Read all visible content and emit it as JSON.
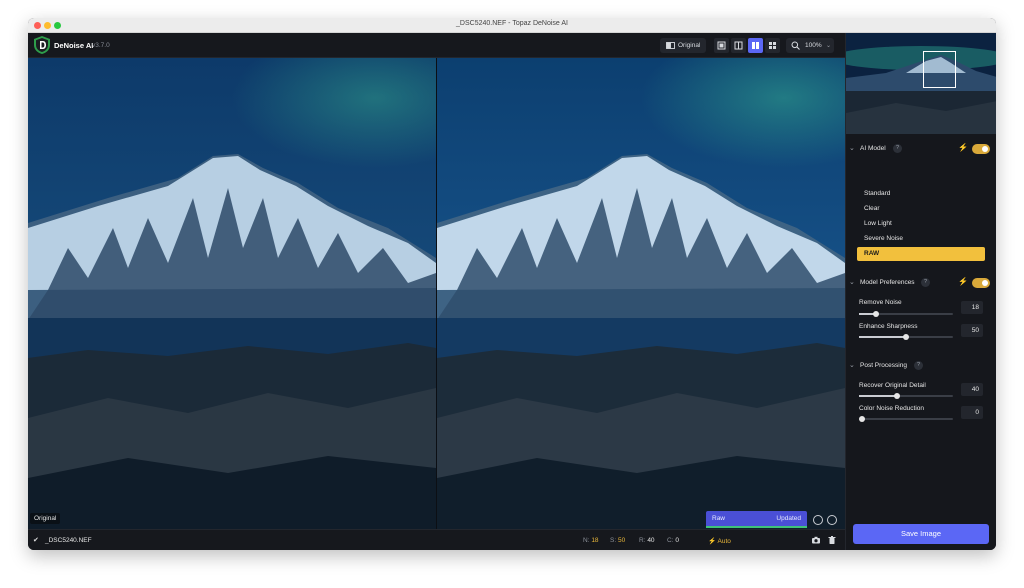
{
  "window": {
    "title": "_DSC5240.NEF - Topaz DeNoise AI"
  },
  "app": {
    "name": "DeNoise AI",
    "version": "v3.7.0"
  },
  "toolbar": {
    "original_label": "Original",
    "view_modes": [
      "single-view",
      "split-view",
      "side-by-side-view",
      "comparison-view"
    ],
    "active_view_mode": "side-by-side-view",
    "zoom_label": "100%"
  },
  "preview": {
    "original_tag": "Original",
    "raw_label": "Raw",
    "updated_label": "Updated"
  },
  "status": {
    "filename": "_DSC5240.NEF",
    "n_label": "N:",
    "n_value": "18",
    "s_label": "S:",
    "s_value": "50",
    "r_label": "R:",
    "r_value": "40",
    "c_label": "C:",
    "c_value": "0",
    "auto_label": "Auto"
  },
  "sidebar": {
    "ai_model": {
      "title": "AI Model",
      "enabled": true,
      "items": [
        "Standard",
        "Clear",
        "Low Light",
        "Severe Noise",
        "RAW"
      ],
      "selected": "RAW"
    },
    "model_preferences": {
      "title": "Model Preferences",
      "enabled": true,
      "remove_noise_label": "Remove Noise",
      "remove_noise_value": "18",
      "enhance_sharpness_label": "Enhance Sharpness",
      "enhance_sharpness_value": "50"
    },
    "post_processing": {
      "title": "Post Processing",
      "recover_detail_label": "Recover Original Detail",
      "recover_detail_value": "40",
      "color_noise_label": "Color Noise Reduction",
      "color_noise_value": "0"
    },
    "save_label": "Save Image"
  },
  "colors": {
    "accent": "#5b67f5",
    "selected_model": "#f2c03d",
    "toggle_on": "#d9a93a",
    "progress": "#3fc27a"
  }
}
